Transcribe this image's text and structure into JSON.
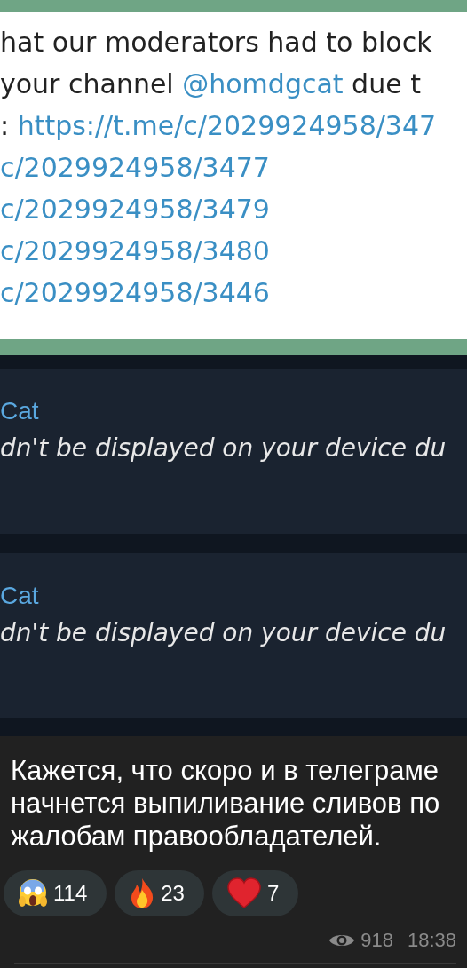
{
  "screenshot": {
    "bubble_lines": [
      [
        {
          "text": "hat our moderators had to block",
          "link": false
        }
      ],
      [
        {
          "text": "your channel ",
          "link": false
        },
        {
          "text": "@homdgcat",
          "link": true
        },
        {
          "text": " due t",
          "link": false
        }
      ],
      [
        {
          "text": ": ",
          "link": false
        },
        {
          "text": "https://t.me/c/2029924958/347",
          "link": true
        }
      ],
      [
        {
          "text": "c/2029924958/3477",
          "link": true
        }
      ],
      [
        {
          "text": "c/2029924958/3479",
          "link": true
        }
      ],
      [
        {
          "text": "c/2029924958/3480",
          "link": true
        }
      ],
      [
        {
          "text": "c/2029924958/3446",
          "link": true
        }
      ]
    ],
    "notices": [
      {
        "sender": "Cat",
        "text": "dn't be displayed on your device du"
      },
      {
        "sender": "Cat",
        "text": "dn't be displayed on your device du"
      }
    ]
  },
  "post": {
    "text": "Кажется, что скоро и в телеграме начнется выпиливание сливов по жалобам правообладателей.",
    "reactions": [
      {
        "kind": "scream",
        "count": "114"
      },
      {
        "kind": "fire",
        "count": "23"
      },
      {
        "kind": "heart",
        "count": "7"
      }
    ],
    "views": "918",
    "time": "18:38"
  }
}
